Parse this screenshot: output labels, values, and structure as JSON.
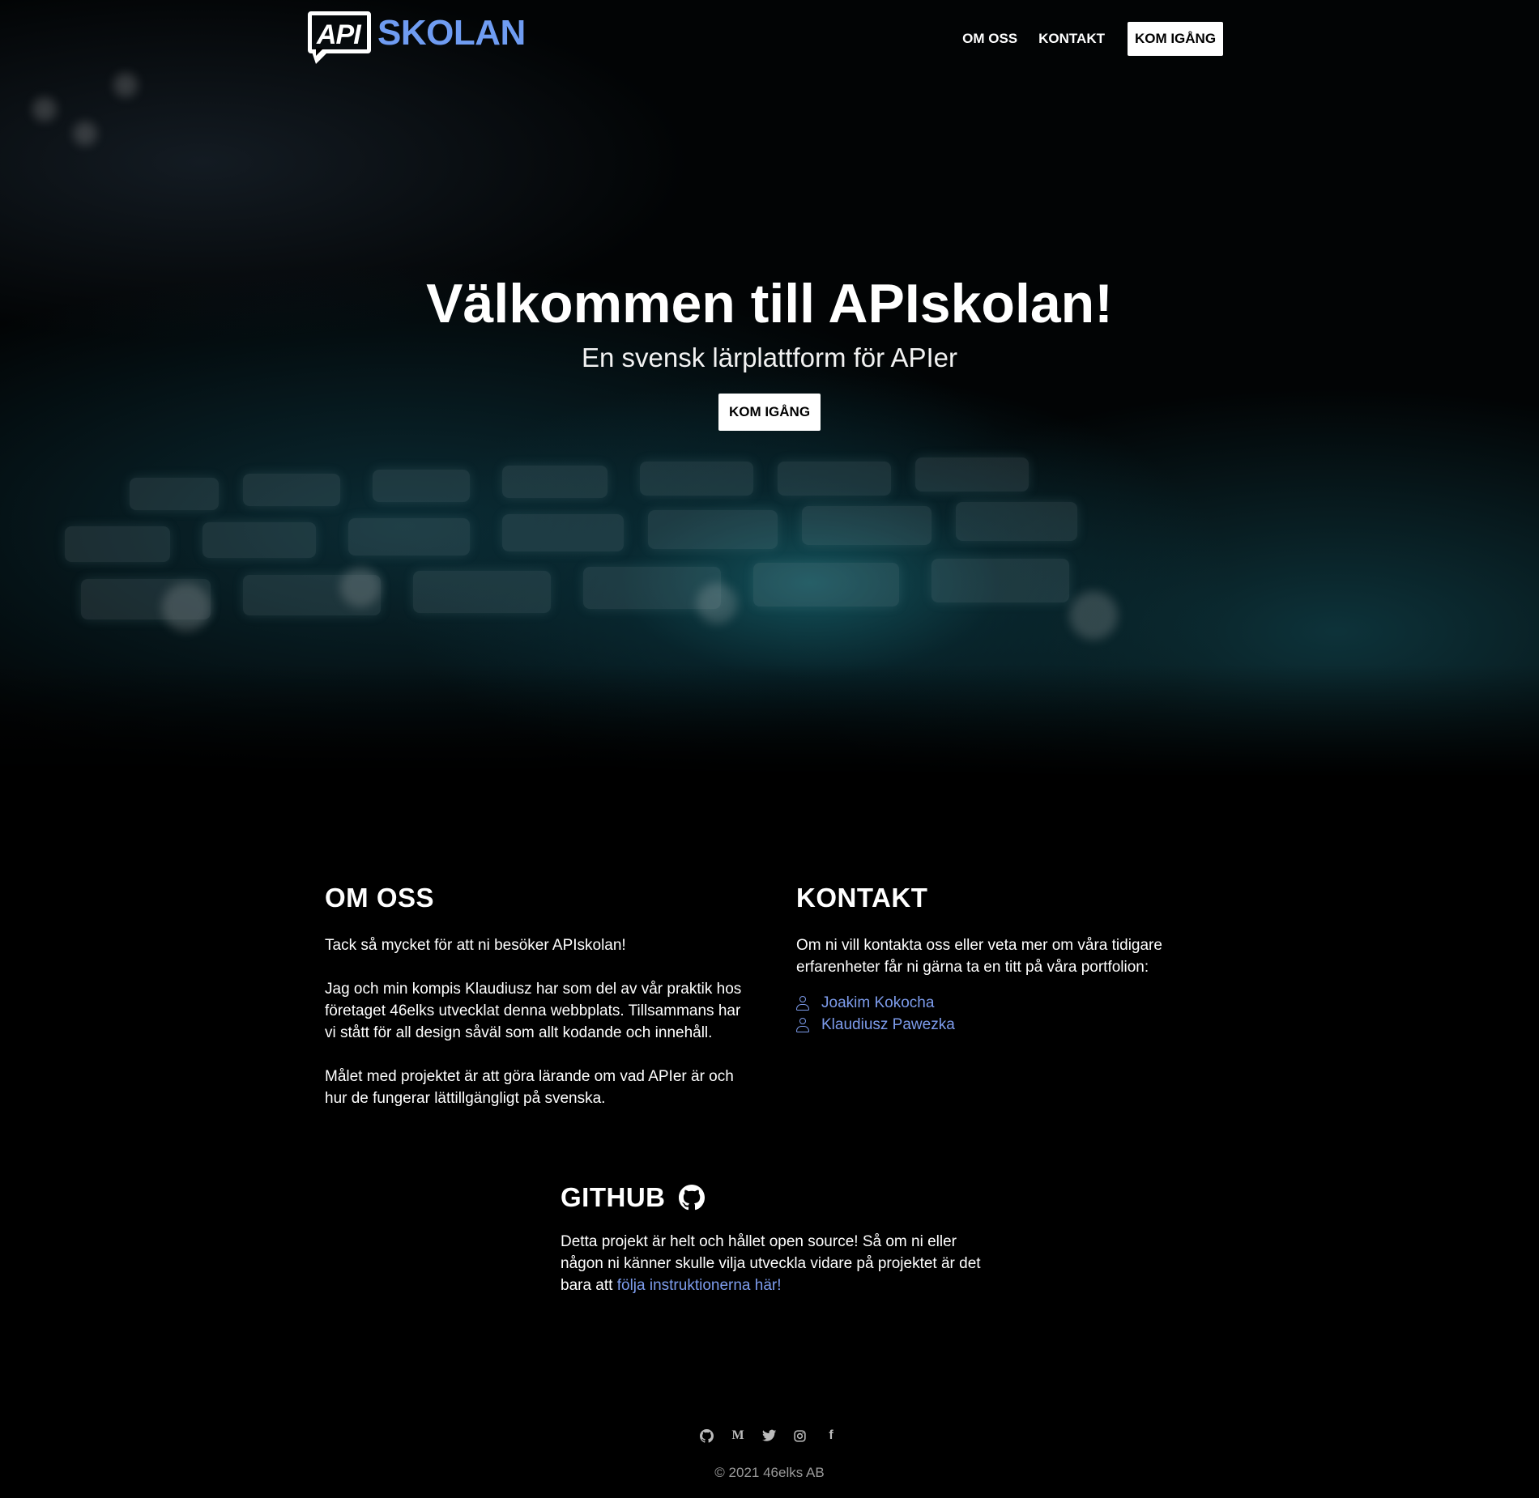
{
  "brand": {
    "logo_api": "API",
    "logo_skolan": "SKOLAN"
  },
  "nav": {
    "about": "OM OSS",
    "contact": "KONTAKT",
    "cta": "KOM IGÅNG"
  },
  "hero": {
    "title": "Välkommen till APIskolan!",
    "subtitle": "En svensk lärplattform för APIer",
    "cta": "KOM IGÅNG"
  },
  "about": {
    "title": "OM OSS",
    "paragraphs": [
      "Tack så mycket för att ni besöker APIskolan!",
      "Jag och min kompis Klaudiusz har som del av vår praktik hos företaget 46elks utvecklat denna webbplats. Tillsammans har vi stått för all design såväl som allt kodande och innehåll.",
      "Målet med projektet är att göra lärande om vad APIer är och hur de fungerar lättillgängligt på svenska."
    ]
  },
  "contact": {
    "title": "KONTAKT",
    "text": "Om ni vill kontakta oss eller veta mer om våra tidigare erfarenheter får ni gärna ta en titt på våra portfolion:",
    "people": [
      "Joakim Kokocha",
      "Klaudiusz Pawezka"
    ]
  },
  "github": {
    "title": "GITHUB",
    "text": "Detta projekt är helt och hållet open source! Så om ni eller någon ni känner skulle vilja utveckla vidare på projektet är det bara att ",
    "link": "följa instruktionerna här!"
  },
  "footer": {
    "social_icons": [
      "github-icon",
      "medium-icon",
      "twitter-icon",
      "instagram-icon",
      "facebook-icon"
    ],
    "medium_glyph": "M",
    "facebook_glyph": "f",
    "copyright": "© 2021 46elks AB"
  },
  "colors": {
    "accent": "#7d9cec",
    "logo_blue": "#6f9cf2",
    "background": "#000000"
  }
}
